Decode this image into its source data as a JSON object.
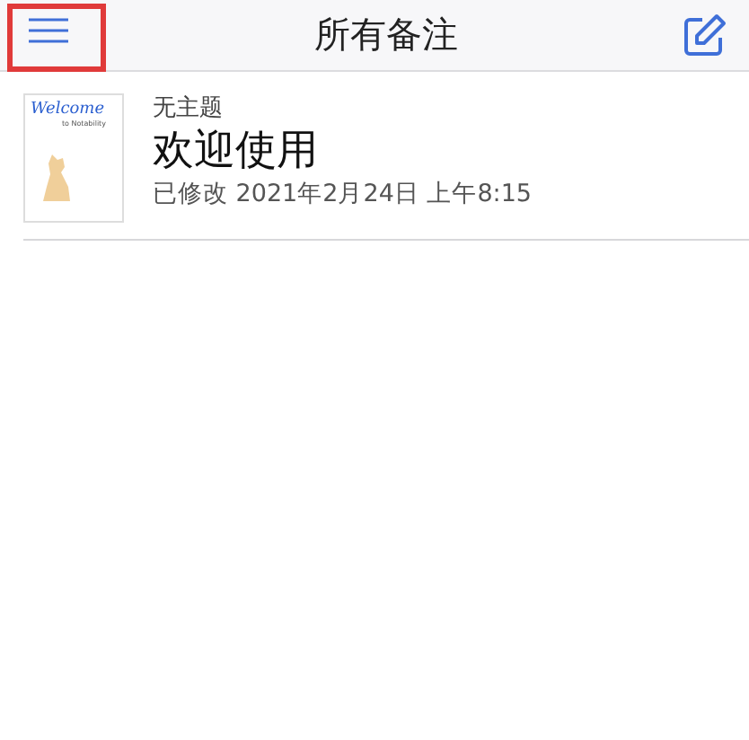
{
  "header": {
    "title": "所有备注",
    "menu_highlighted": true
  },
  "notes": [
    {
      "thumbnail": {
        "heading": "Welcome",
        "subheading": "to Notability"
      },
      "subject": "无主题",
      "title": "欢迎使用",
      "modified": "已修改 2021年2月24日 上午8:15"
    }
  ]
}
